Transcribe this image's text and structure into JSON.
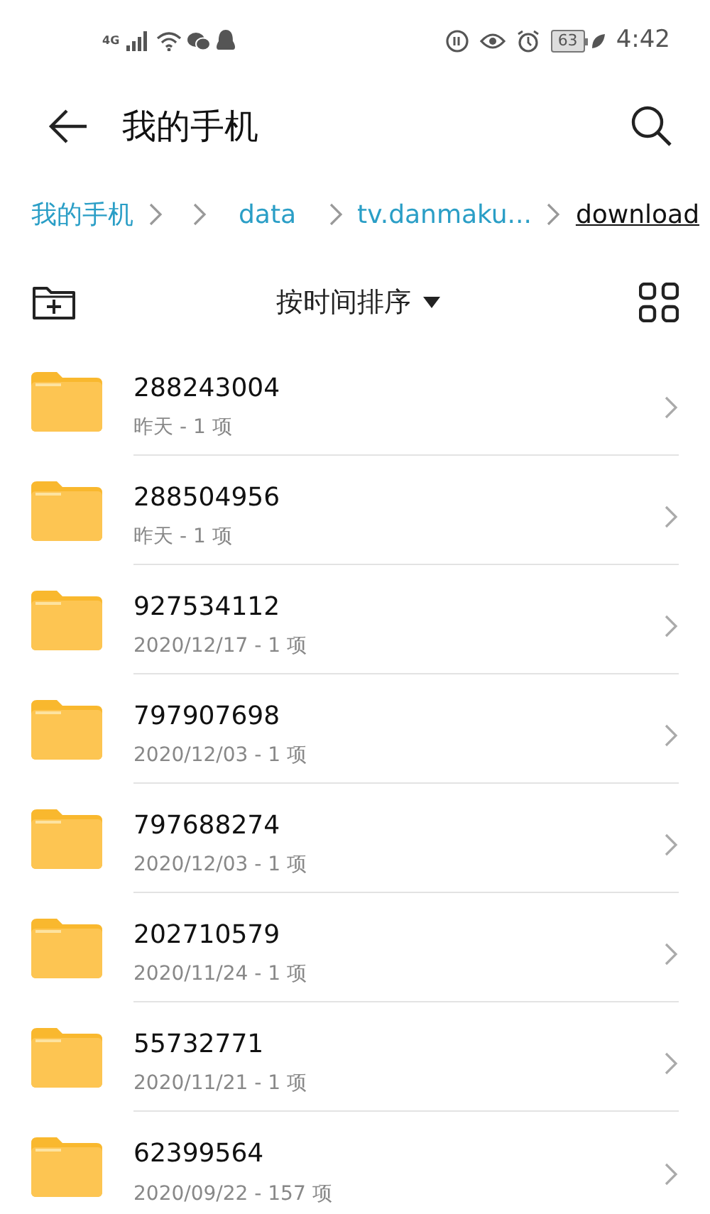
{
  "status_bar": {
    "network": "4G",
    "battery": "63",
    "time": "4:42"
  },
  "toolbar": {
    "title": "我的手机"
  },
  "breadcrumb": [
    {
      "kind": "crumb",
      "label": "我的手机",
      "current": false
    },
    {
      "kind": "blank"
    },
    {
      "kind": "crumb",
      "label": "data",
      "current": false
    },
    {
      "kind": "crumb",
      "label": "tv.danmaku...",
      "current": false
    },
    {
      "kind": "crumb",
      "label": "download",
      "current": true
    }
  ],
  "sort": {
    "label": "按时间排序"
  },
  "folders": [
    {
      "name": "288243004",
      "detail": "昨天 - 1 项"
    },
    {
      "name": "288504956",
      "detail": "昨天 - 1 项"
    },
    {
      "name": "927534112",
      "detail": "2020/12/17 - 1 项"
    },
    {
      "name": "797907698",
      "detail": "2020/12/03 - 1 项"
    },
    {
      "name": "797688274",
      "detail": "2020/12/03 - 1 项"
    },
    {
      "name": "202710579",
      "detail": "2020/11/24 - 1 项"
    },
    {
      "name": "55732771",
      "detail": "2020/11/21 - 1 项"
    },
    {
      "name": "62399564",
      "detail": "2020/09/22 - 157 项"
    }
  ]
}
